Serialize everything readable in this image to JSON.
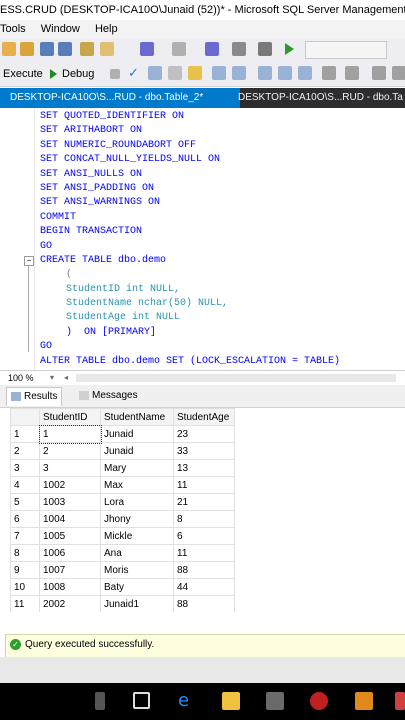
{
  "window": {
    "title": "ESS.CRUD (DESKTOP-ICA10O\\Junaid (52))* - Microsoft SQL Server Management Studio"
  },
  "menu": {
    "items": [
      "Tools",
      "Window",
      "Help"
    ]
  },
  "toolbar": {
    "execute_label": "Execute",
    "debug_label": "Debug"
  },
  "tabs": [
    {
      "label": "DESKTOP-ICA10O\\S...RUD - dbo.Table_2*"
    },
    {
      "label": "DESKTOP-ICA10O\\S...RUD - dbo.Ta"
    }
  ],
  "editor": {
    "lines": [
      "SET QUOTED_IDENTIFIER ON",
      "SET ARITHABORT ON",
      "SET NUMERIC_ROUNDABORT OFF",
      "SET CONCAT_NULL_YIELDS_NULL ON",
      "SET ANSI_NULLS ON",
      "SET ANSI_PADDING ON",
      "SET ANSI_WARNINGS ON",
      "COMMIT",
      "BEGIN TRANSACTION",
      "GO",
      "CREATE TABLE dbo.demo",
      "(",
      "StudentID int NULL,",
      "StudentName nchar(50) NULL,",
      "StudentAge int NULL",
      ")  ON [PRIMARY]",
      "GO",
      "ALTER TABLE dbo.demo SET (LOCK_ESCALATION = TABLE)"
    ]
  },
  "zoom": {
    "value": "100 %"
  },
  "results": {
    "tab_results": "Results",
    "tab_messages": "Messages",
    "columns": [
      "StudentID",
      "StudentName",
      "StudentAge"
    ],
    "rows": [
      [
        "1",
        "1",
        "Junaid",
        "23"
      ],
      [
        "2",
        "2",
        "Junaid",
        "33"
      ],
      [
        "3",
        "3",
        "Mary",
        "13"
      ],
      [
        "4",
        "1002",
        "Max",
        "11"
      ],
      [
        "5",
        "1003",
        "Lora",
        "21"
      ],
      [
        "6",
        "1004",
        "Jhony",
        "8"
      ],
      [
        "7",
        "1005",
        "Mickle",
        "6"
      ],
      [
        "8",
        "1006",
        "Ana",
        "11"
      ],
      [
        "9",
        "1007",
        "Moris",
        "88"
      ],
      [
        "10",
        "1008",
        "Baty",
        "44"
      ],
      [
        "11",
        "2002",
        "Junaid1",
        "88"
      ]
    ]
  },
  "status": {
    "text": "Query executed successfully."
  },
  "colors": {
    "accent": "#007acc",
    "keyword": "#0000ff",
    "success": "#2e9e2e"
  }
}
